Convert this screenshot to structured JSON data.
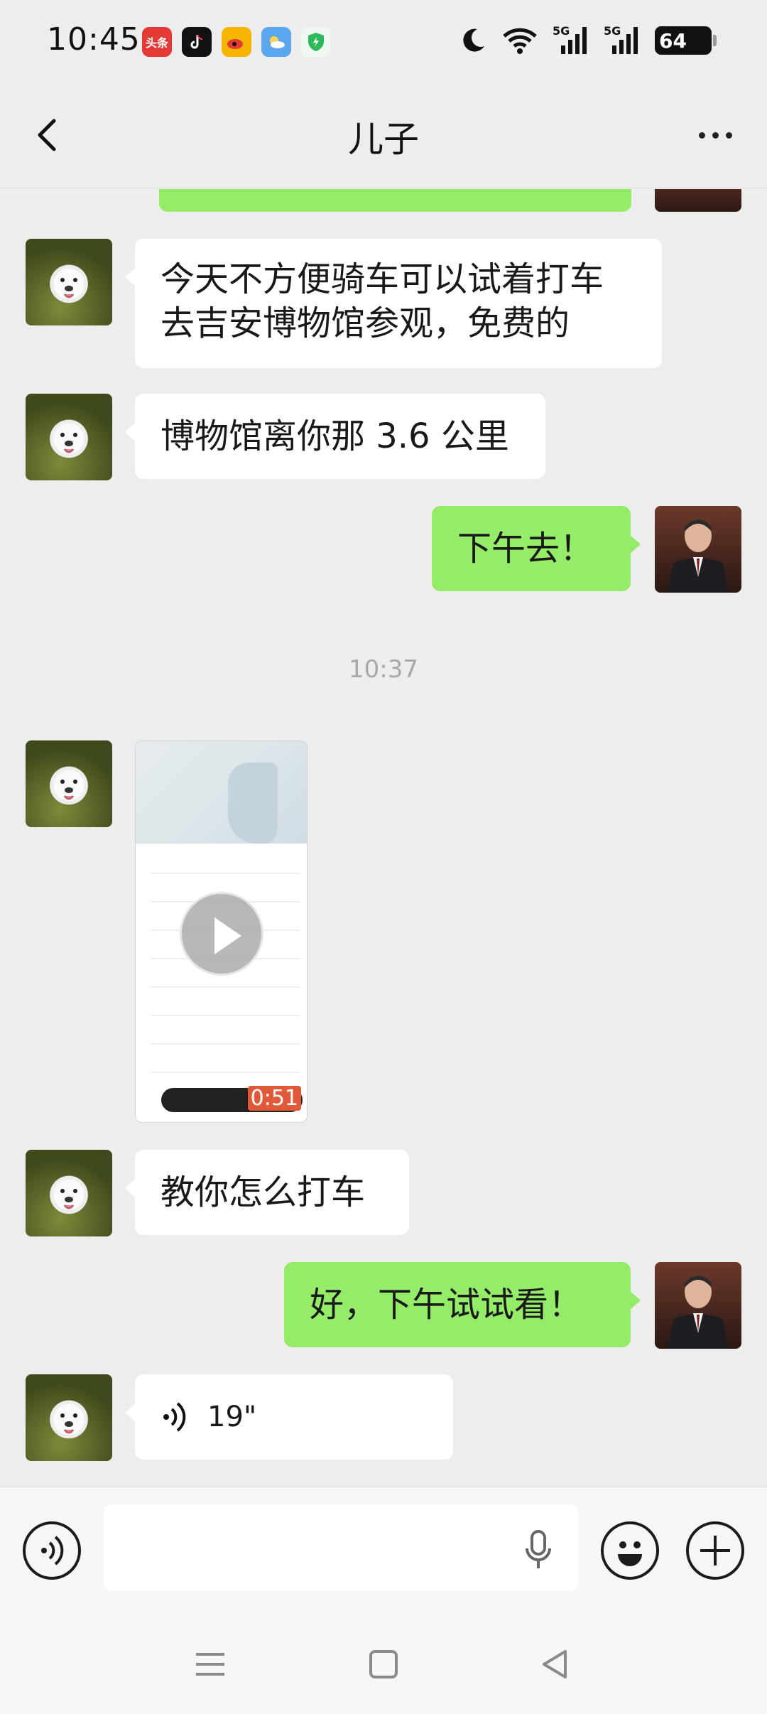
{
  "status_bar": {
    "time": "10:45",
    "app_icons": [
      {
        "name": "toutiao-icon",
        "label": "头条",
        "color": "#e53935"
      },
      {
        "name": "tiktok-icon",
        "label": "",
        "color": "#111111"
      },
      {
        "name": "weibo-icon",
        "label": "",
        "color": "#f4b400"
      },
      {
        "name": "weather-icon",
        "label": "",
        "color": "#5aa7ef"
      },
      {
        "name": "shield-icon",
        "label": "",
        "color": "#2eb85c"
      }
    ],
    "signal_label_1": "5G",
    "signal_label_2": "5G",
    "battery": "64"
  },
  "header": {
    "title": "儿子"
  },
  "messages": [
    {
      "sender": "other",
      "type": "text",
      "text": "今天不方便骑车可以试着打车去吉安博物馆参观，免费的"
    },
    {
      "sender": "other",
      "type": "text",
      "text": "博物馆离你那 3.6 公里"
    },
    {
      "sender": "self",
      "type": "text",
      "text": "下午去！"
    },
    {
      "type": "timestamp",
      "text": "10:37"
    },
    {
      "sender": "other",
      "type": "video",
      "duration": "0:51"
    },
    {
      "sender": "other",
      "type": "text",
      "text": "教你怎么打车"
    },
    {
      "sender": "self",
      "type": "text",
      "text": "好，下午试试看！"
    },
    {
      "sender": "other",
      "type": "voice",
      "duration": "19\""
    }
  ],
  "input_bar": {
    "value": "",
    "placeholder": ""
  },
  "colors": {
    "chat_background": "#ededed",
    "self_bubble": "#95ec69",
    "other_bubble": "#ffffff",
    "timestamp_text": "#a8a8a8"
  }
}
